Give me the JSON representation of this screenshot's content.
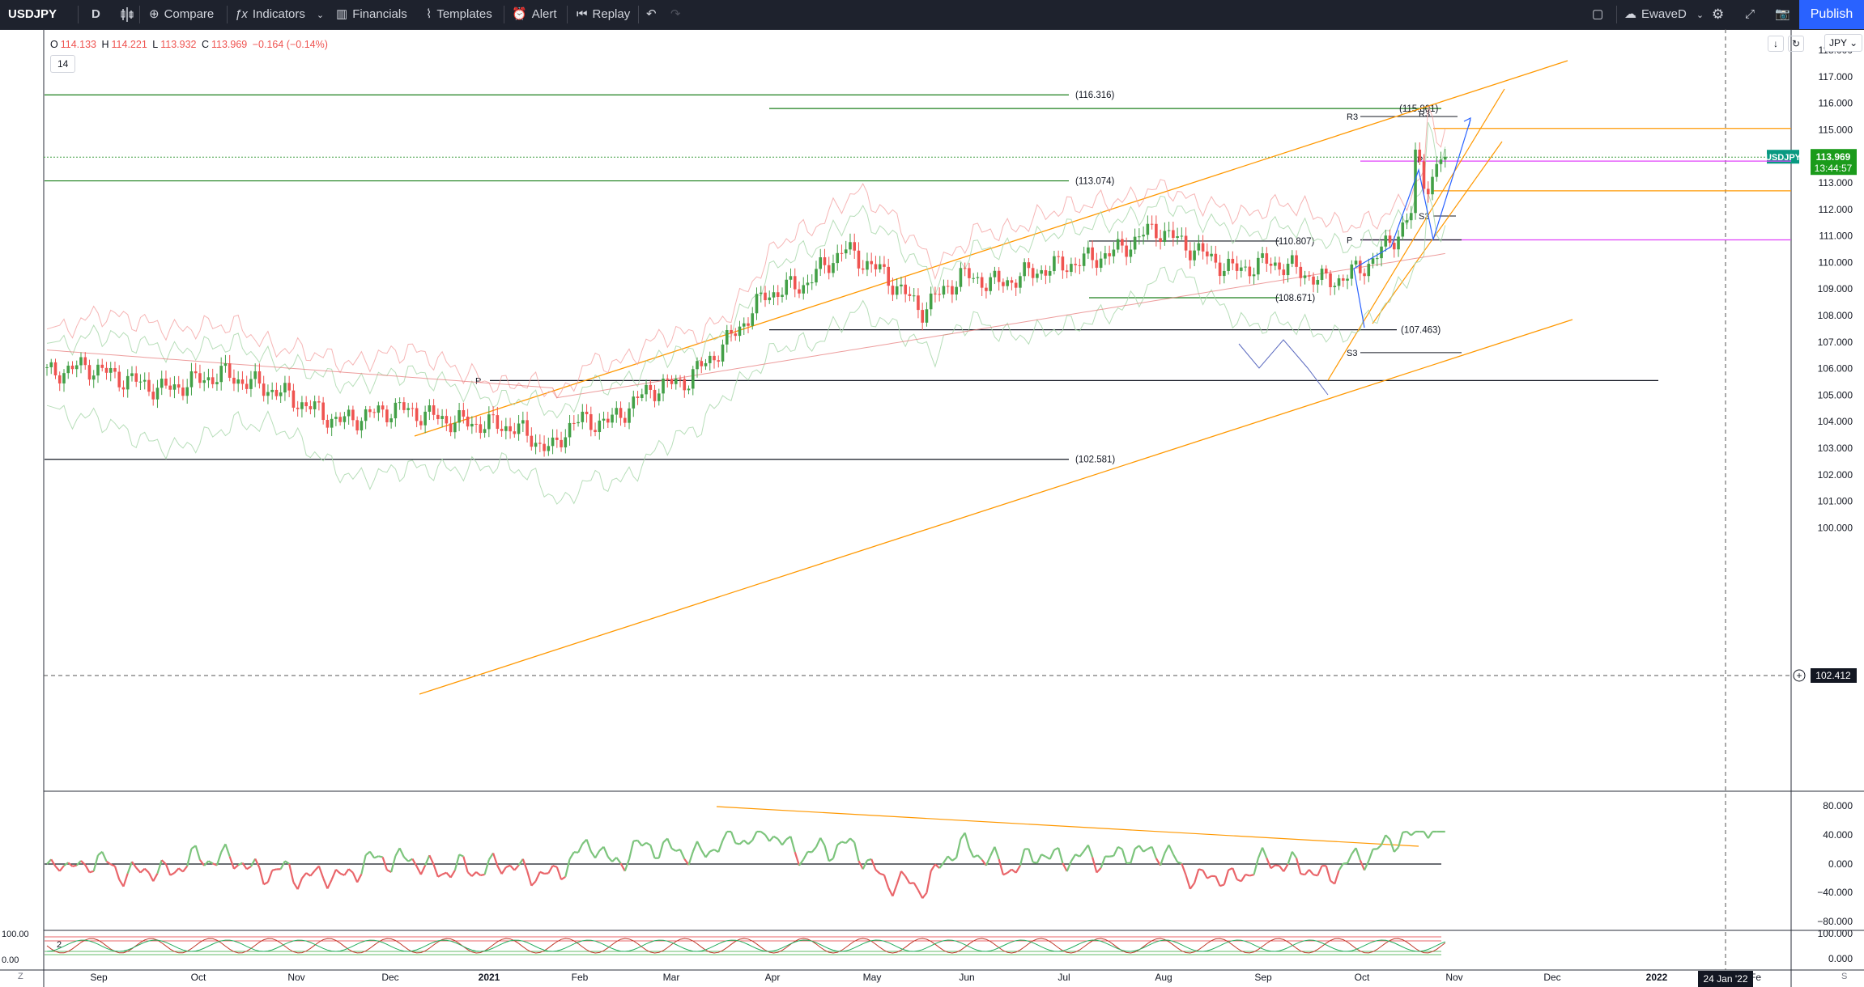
{
  "toolbar": {
    "symbol": "USDJPY",
    "interval": "D",
    "compare": "Compare",
    "indicators": "Indicators",
    "financials": "Financials",
    "templates": "Templates",
    "alert": "Alert",
    "replay": "Replay",
    "layout_name": "EwaveD",
    "publish": "Publish"
  },
  "legend": {
    "o_label": "O",
    "o_value": "114.133",
    "h_label": "H",
    "h_value": "114.221",
    "l_label": "L",
    "l_value": "113.932",
    "c_label": "C",
    "c_value": "113.969",
    "change": "−0.164 (−0.14%)",
    "indicator_length": "14"
  },
  "currency_label": "JPY",
  "price_axis": [
    "118.000",
    "117.000",
    "116.000",
    "115.000",
    "114.000",
    "113.000",
    "112.000",
    "111.000",
    "110.000",
    "109.000",
    "108.000",
    "107.000",
    "106.000",
    "105.000",
    "104.000",
    "103.000",
    "102.000",
    "101.000",
    "100.000"
  ],
  "rsi_axis": [
    "80.000",
    "40.000",
    "0.000",
    "−40.000",
    "−80.000"
  ],
  "osc_axis": [
    "100.000",
    "0.000"
  ],
  "osc_left_labels": [
    "100.00",
    "0.00"
  ],
  "osc_count": "2",
  "time_axis": [
    "Sep",
    "Oct",
    "Nov",
    "Dec",
    "2021",
    "Feb",
    "Mar",
    "Apr",
    "May",
    "Jun",
    "Jul",
    "Aug",
    "Sep",
    "Oct",
    "Nov",
    "Dec",
    "2022",
    "Fe"
  ],
  "crosshair_date": "24 Jan '22",
  "crosshair_price": "102.412",
  "symbol_tag": "USDJPY",
  "last_price": "113.969",
  "countdown": "13:44:57",
  "level_labels": {
    "l116316": "(116.316)",
    "l115801": "(115.801)",
    "l113074": "(113.074)",
    "l110807": "(110.807)",
    "l108671": "(108.671)",
    "l107463": "(107.463)",
    "l102581": "(102.581)"
  },
  "pivot_labels": {
    "r3a": "R3",
    "r3b": "R3",
    "p1": "P",
    "p2": "P",
    "p3": "P",
    "s3a": "S3",
    "s3b": "S3"
  },
  "colors": {
    "up": "#26a69a",
    "up_candle": "#43a047",
    "down": "#ef5350",
    "accent": "#2962ff",
    "orange": "#ff9800",
    "green_line": "#1b7f1b",
    "magenta": "#e040fb"
  },
  "icons": [
    "plus-circle-icon",
    "indicators-icon",
    "financials-icon",
    "templates-icon",
    "alert-icon",
    "replay-icon",
    "undo-icon",
    "redo-icon",
    "fullscreen-icon",
    "cloud-icon",
    "settings-icon",
    "camera-icon"
  ]
}
